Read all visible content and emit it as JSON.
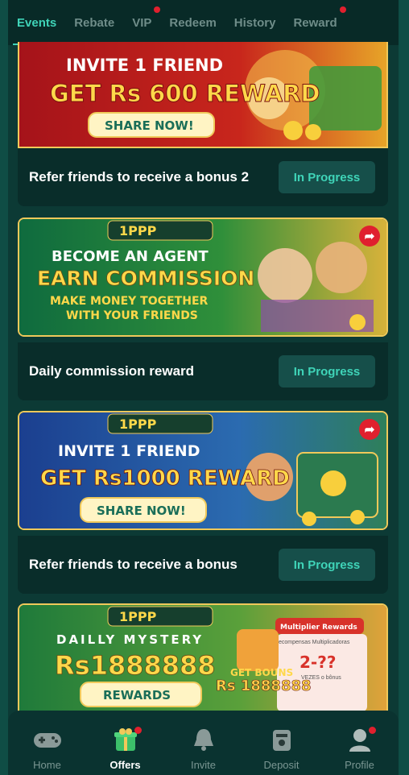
{
  "tabs": [
    {
      "label": "Events",
      "active": true,
      "dot": false
    },
    {
      "label": "Rebate",
      "active": false,
      "dot": false
    },
    {
      "label": "VIP",
      "active": false,
      "dot": true
    },
    {
      "label": "Redeem",
      "active": false,
      "dot": false
    },
    {
      "label": "History",
      "active": false,
      "dot": false
    },
    {
      "label": "Reward",
      "active": false,
      "dot": true
    }
  ],
  "banners": [
    {
      "brand": "",
      "line1": "INVITE 1 FRIEND",
      "line2": "GET Rs 600 REWARD",
      "line3": "",
      "cta": "SHARE NOW!"
    },
    {
      "brand": "1PPP",
      "line1": "BECOME AN AGENT",
      "line2": "EARN COMMISSION",
      "line3": "MAKE MONEY TOGETHER",
      "line4": "WITH YOUR FRIENDS",
      "cta": ""
    },
    {
      "brand": "1PPP",
      "line1": "INVITE 1 FRIEND",
      "line2": "GET Rs1000 REWARD",
      "line3": "",
      "cta": "SHARE NOW!"
    },
    {
      "brand": "1PPP",
      "line1": "DAILLY MYSTERY",
      "line2": "Rs1888888",
      "line3": "",
      "cta": "REWARDS",
      "side_title": "Multiplier Rewards",
      "side_sub": "ecompensas Multiplicadoras",
      "side_value": "2-??",
      "side_note": "VEZES o bônus",
      "get_label": "GET BOUNS",
      "get_value": "Rs 1888888"
    }
  ],
  "events": [
    {
      "title": "Refer friends to receive a bonus 2",
      "status": "In Progress"
    },
    {
      "title": "Daily commission reward",
      "status": "In Progress"
    },
    {
      "title": "Refer friends to receive a bonus",
      "status": "In Progress"
    }
  ],
  "nav": [
    {
      "label": "Home",
      "icon": "gamepad-icon",
      "active": false,
      "dot": false
    },
    {
      "label": "Offers",
      "icon": "gift-icon",
      "active": true,
      "dot": true
    },
    {
      "label": "Invite",
      "icon": "bell-icon",
      "active": false,
      "dot": false
    },
    {
      "label": "Deposit",
      "icon": "wallet-icon",
      "active": false,
      "dot": false
    },
    {
      "label": "Profile",
      "icon": "user-icon",
      "active": false,
      "dot": true
    }
  ],
  "colors": {
    "accent": "#3fd4b8",
    "background": "#0c3a35",
    "dot": "#e0202e",
    "gold": "#f0c95a"
  }
}
